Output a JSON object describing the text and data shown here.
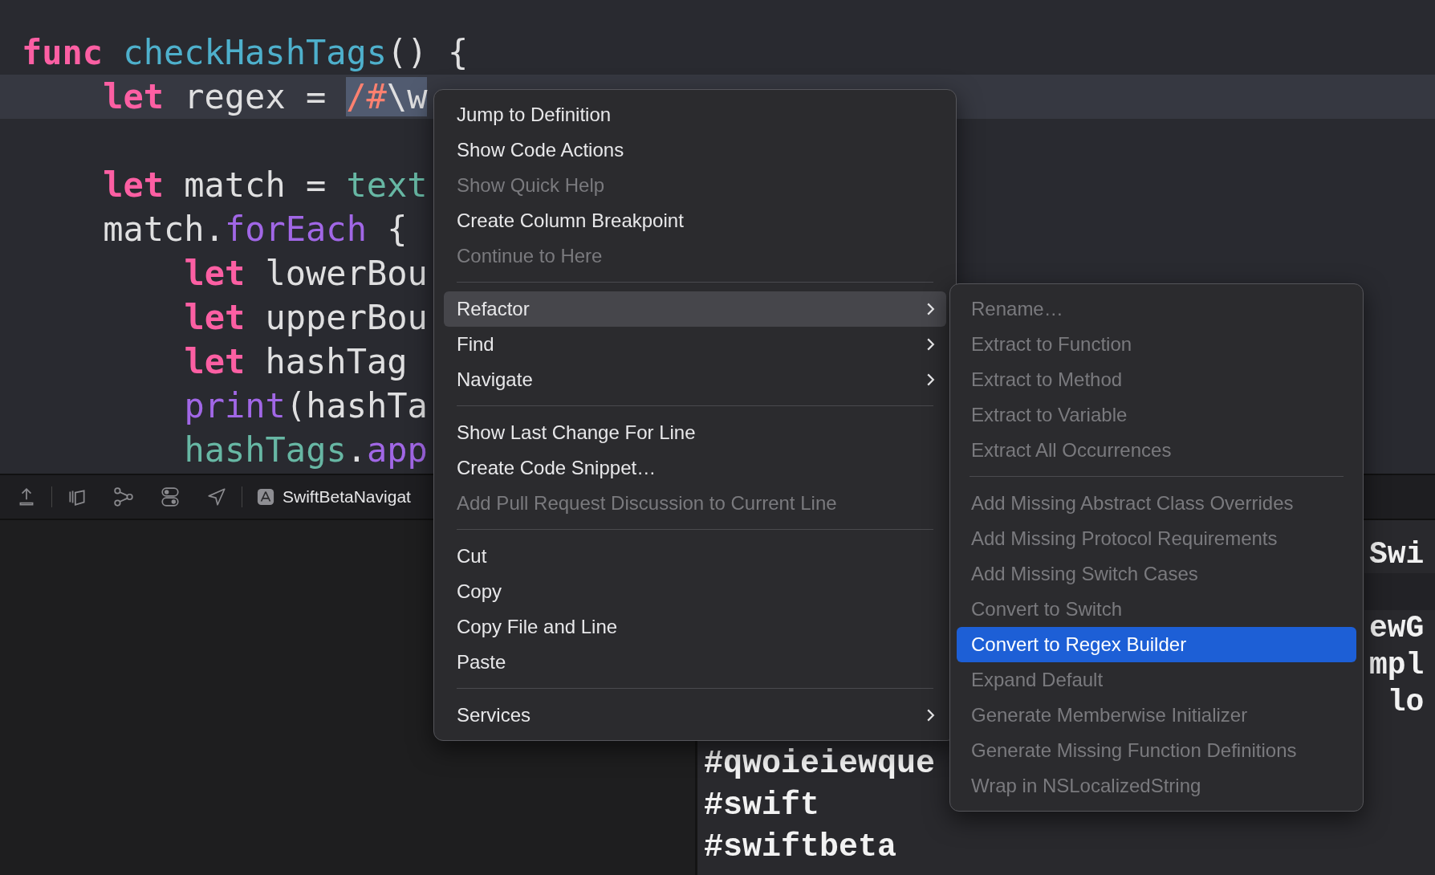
{
  "editor": {
    "lines": [
      {
        "current": false,
        "tokens": [
          {
            "text": "func",
            "kind": "keyword",
            "selected": false
          },
          {
            "text": "checkHashTags",
            "kind": "function",
            "selected": false,
            "space_before": true
          },
          {
            "text": "() {",
            "kind": "plain",
            "selected": false
          }
        ],
        "children": [
          {
            "current": true,
            "tokens": [
              {
                "text": "let",
                "kind": "keyword",
                "selected": false
              },
              {
                "text": "regex =",
                "kind": "plain",
                "selected": false,
                "space_before": true
              },
              {
                "text": "/#",
                "kind": "regex",
                "selected": true,
                "space_before": true
              },
              {
                "text": "\\w",
                "kind": "plain",
                "selected": true
              }
            ]
          },
          {
            "current": false
          },
          {
            "current": false,
            "tokens": [
              {
                "text": "let",
                "kind": "keyword",
                "selected": false
              },
              {
                "text": "match =",
                "kind": "plain",
                "selected": false,
                "space_before": true
              },
              {
                "text": "text",
                "kind": "variable",
                "selected": false,
                "space_before": true
              }
            ]
          },
          {
            "current": false,
            "tokens": [
              {
                "text": "match.",
                "kind": "plain",
                "selected": false
              },
              {
                "text": "forEach",
                "kind": "method",
                "selected": false
              },
              {
                "text": "{",
                "kind": "plain",
                "selected": false,
                "space_before": true
              }
            ],
            "children": [
              {
                "current": false,
                "tokens": [
                  {
                    "text": "let",
                    "kind": "keyword",
                    "selected": false
                  },
                  {
                    "text": "lowerBou",
                    "kind": "plain",
                    "selected": false,
                    "space_before": true
                  }
                ]
              },
              {
                "current": false,
                "tokens": [
                  {
                    "text": "let",
                    "kind": "keyword",
                    "selected": false
                  },
                  {
                    "text": "upperBou",
                    "kind": "plain",
                    "selected": false,
                    "space_before": true
                  }
                ]
              },
              {
                "current": false,
                "tokens": [
                  {
                    "text": "let",
                    "kind": "keyword",
                    "selected": false
                  },
                  {
                    "text": "hashTag",
                    "kind": "plain",
                    "selected": false,
                    "space_before": true
                  }
                ]
              },
              {
                "current": false,
                "tokens": [
                  {
                    "text": "print",
                    "kind": "method",
                    "selected": false
                  },
                  {
                    "text": "(hashTa",
                    "kind": "plain",
                    "selected": false
                  }
                ]
              },
              {
                "current": false,
                "tokens": [
                  {
                    "text": "hashTags",
                    "kind": "variable",
                    "selected": false
                  },
                  {
                    "text": ".",
                    "kind": "plain",
                    "selected": false
                  },
                  {
                    "text": "app",
                    "kind": "method",
                    "selected": false
                  }
                ]
              }
            ]
          }
        ]
      }
    ]
  },
  "debug_bar": {
    "target": "SwiftBetaNavigat"
  },
  "console": {
    "lines": [
      "#qwoieiewque",
      "#swift",
      "#swiftbeta"
    ],
    "right_fragments": [
      {
        "text": "Swi",
        "gap_before": false
      },
      {
        "text": "ewG",
        "gap_before": true
      },
      {
        "text": "mpl",
        "gap_before": false
      },
      {
        "text": " lo",
        "gap_before": false
      }
    ]
  },
  "context_menu": {
    "items": [
      {
        "kind": "item",
        "label": "Jump to Definition",
        "disabled": false,
        "selected": false
      },
      {
        "kind": "item",
        "label": "Show Code Actions",
        "disabled": false,
        "selected": false
      },
      {
        "kind": "item",
        "label": "Show Quick Help",
        "disabled": true,
        "selected": false
      },
      {
        "kind": "item",
        "label": "Create Column Breakpoint",
        "disabled": false,
        "selected": false
      },
      {
        "kind": "item",
        "label": "Continue to Here",
        "disabled": true,
        "selected": false
      },
      {
        "kind": "separator"
      },
      {
        "kind": "submenu",
        "label": "Refactor",
        "disabled": false,
        "selected": true
      },
      {
        "kind": "submenu",
        "label": "Find",
        "disabled": false,
        "selected": false
      },
      {
        "kind": "submenu",
        "label": "Navigate",
        "disabled": false,
        "selected": false
      },
      {
        "kind": "separator"
      },
      {
        "kind": "item",
        "label": "Show Last Change For Line",
        "disabled": false,
        "selected": false
      },
      {
        "kind": "item",
        "label": "Create Code Snippet…",
        "disabled": false,
        "selected": false
      },
      {
        "kind": "item",
        "label": "Add Pull Request Discussion to Current Line",
        "disabled": true,
        "selected": false
      },
      {
        "kind": "separator"
      },
      {
        "kind": "item",
        "label": "Cut",
        "disabled": false,
        "selected": false
      },
      {
        "kind": "item",
        "label": "Copy",
        "disabled": false,
        "selected": false
      },
      {
        "kind": "item",
        "label": "Copy File and Line",
        "disabled": false,
        "selected": false
      },
      {
        "kind": "item",
        "label": "Paste",
        "disabled": false,
        "selected": false
      },
      {
        "kind": "separator"
      },
      {
        "kind": "submenu",
        "label": "Services",
        "disabled": false,
        "selected": false
      }
    ]
  },
  "refactor_submenu": {
    "items": [
      {
        "kind": "item",
        "label": "Rename…",
        "disabled": true,
        "selected": false
      },
      {
        "kind": "item",
        "label": "Extract to Function",
        "disabled": true,
        "selected": false
      },
      {
        "kind": "item",
        "label": "Extract to Method",
        "disabled": true,
        "selected": false
      },
      {
        "kind": "item",
        "label": "Extract to Variable",
        "disabled": true,
        "selected": false
      },
      {
        "kind": "item",
        "label": "Extract All Occurrences",
        "disabled": true,
        "selected": false
      },
      {
        "kind": "separator"
      },
      {
        "kind": "item",
        "label": "Add Missing Abstract Class Overrides",
        "disabled": true,
        "selected": false
      },
      {
        "kind": "item",
        "label": "Add Missing Protocol Requirements",
        "disabled": true,
        "selected": false
      },
      {
        "kind": "item",
        "label": "Add Missing Switch Cases",
        "disabled": true,
        "selected": false
      },
      {
        "kind": "item",
        "label": "Convert to Switch",
        "disabled": true,
        "selected": false
      },
      {
        "kind": "item",
        "label": "Convert to Regex Builder",
        "disabled": false,
        "selected": true
      },
      {
        "kind": "item",
        "label": "Expand Default",
        "disabled": true,
        "selected": false
      },
      {
        "kind": "item",
        "label": "Generate Memberwise Initializer",
        "disabled": true,
        "selected": false
      },
      {
        "kind": "item",
        "label": "Generate Missing Function Definitions",
        "disabled": true,
        "selected": false
      },
      {
        "kind": "item",
        "label": "Wrap in NSLocalizedString",
        "disabled": true,
        "selected": false
      }
    ]
  }
}
